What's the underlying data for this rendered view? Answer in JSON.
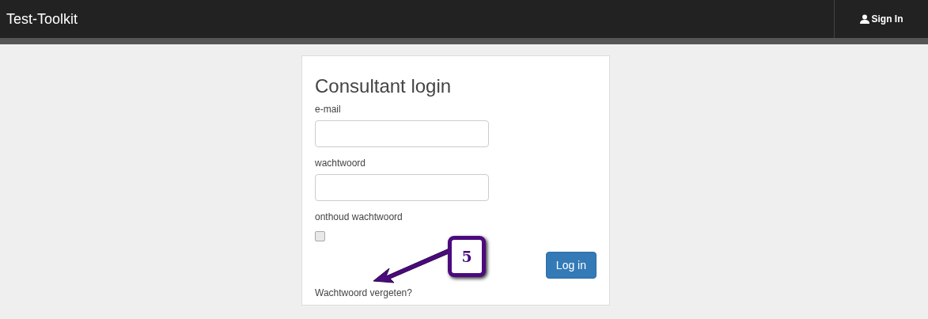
{
  "navbar": {
    "brand": "Test-Toolkit",
    "sign_in": "Sign In"
  },
  "login": {
    "title": "Consultant login",
    "fields": [
      {
        "label": "e-mail"
      },
      {
        "label": "wachtwoord"
      }
    ],
    "remember": {
      "label": "onthoud wachtwoord",
      "checked": false
    },
    "submit": "Log in",
    "forgot": "Wachtwoord vergeten?"
  },
  "annotation": {
    "number": "5"
  }
}
